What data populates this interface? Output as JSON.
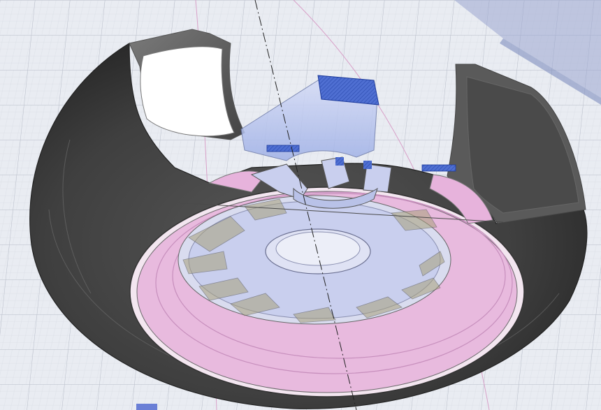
{
  "viewport": {
    "view_mode": "3D section view",
    "grid_visible": true,
    "grid_major_color": "#b7bcc8",
    "grid_minor_color": "#d7dbe3",
    "background_color": "#e9ecf2"
  },
  "model": {
    "tire_color": "#3f3f3f",
    "tire_highlight": "#6a6a6a",
    "section_edge_color": "#9a9a9a",
    "rim_transparent_color": "#e7b3dc",
    "spoke_body_color": "#c9cfee",
    "spoke_cut_face_color": "#5a78d6",
    "bracket_color": "#b7c2ee",
    "construction_line_color": "#d8a0c8",
    "axis_line_color": "#222222"
  },
  "icons": {
    "axis": "axis-line-icon",
    "section": "section-plane-icon"
  }
}
